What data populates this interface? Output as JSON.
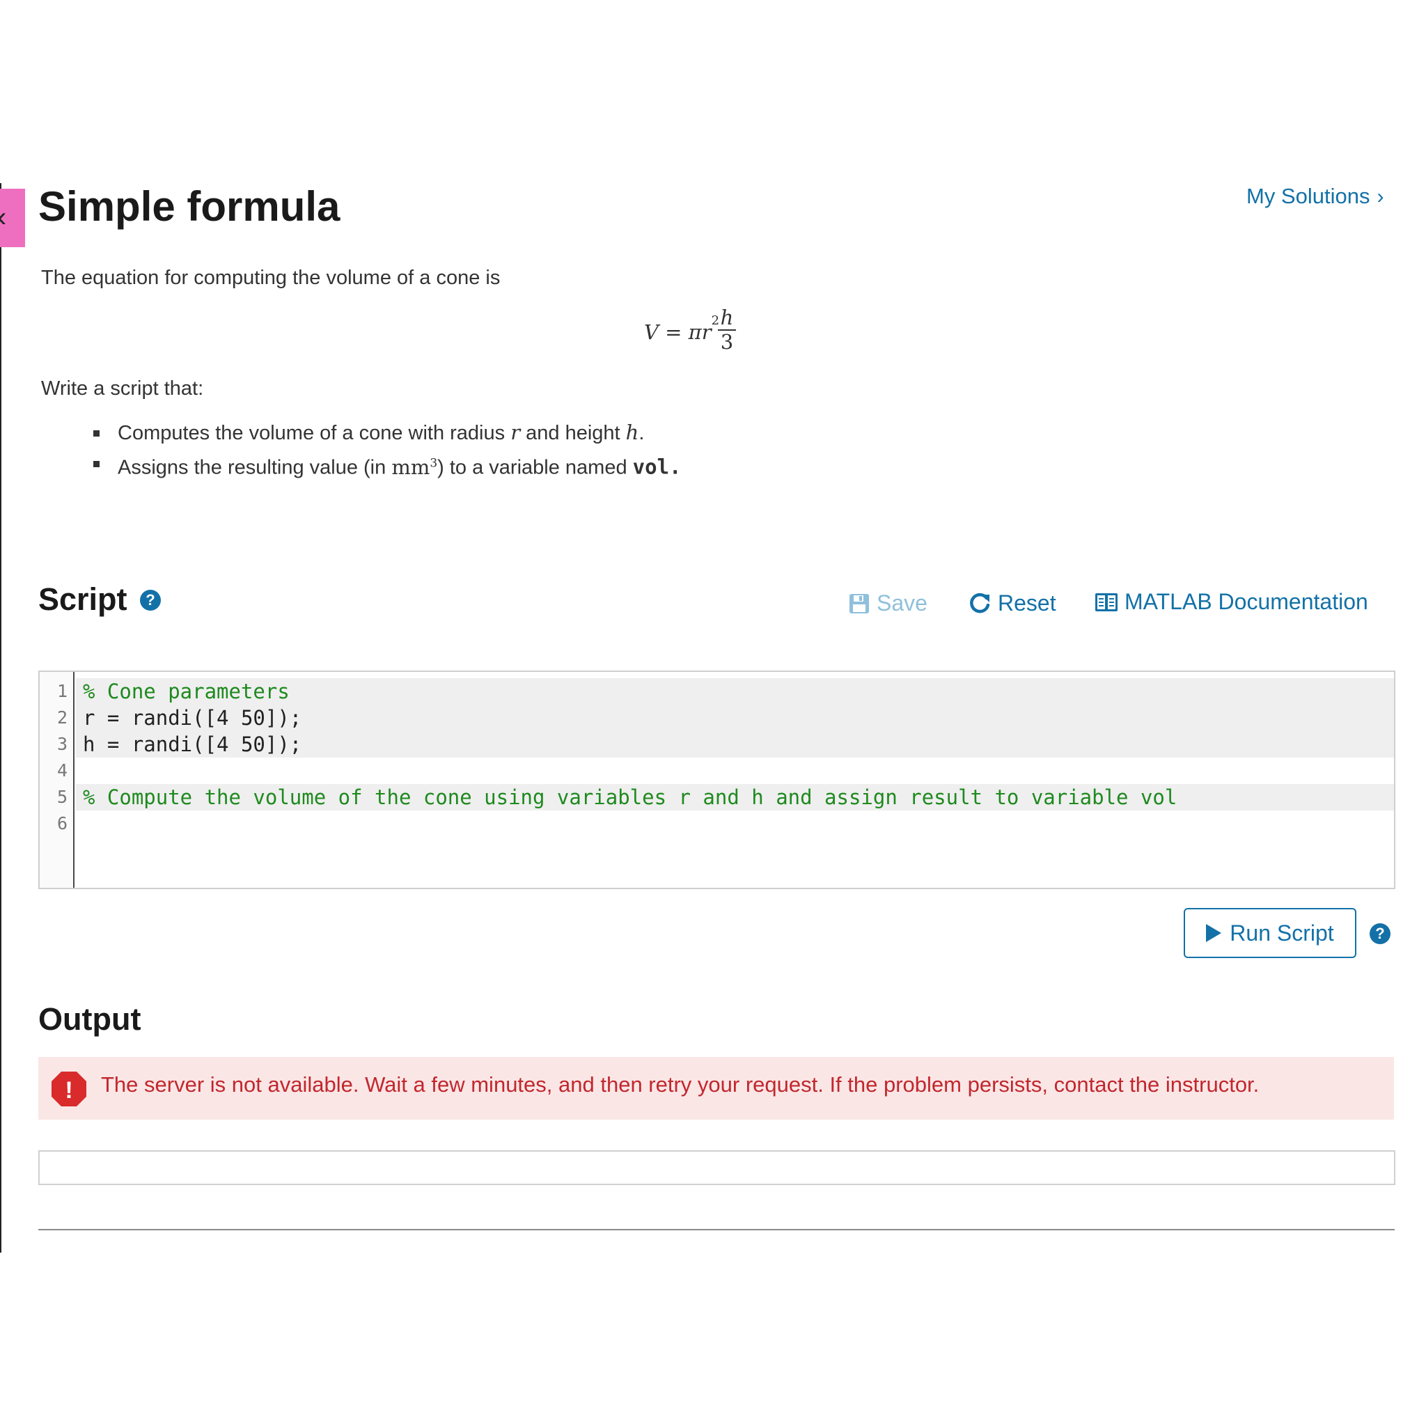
{
  "nav": {
    "tab_chevron": "‹"
  },
  "header": {
    "title": "Simple formula",
    "my_solutions_label": "My Solutions",
    "my_solutions_chevron": "›"
  },
  "problem": {
    "intro": "The equation for computing the volume of a cone is",
    "formula": {
      "lhs": "V = πr",
      "exponent": "2",
      "numerator": "h",
      "denominator": "3"
    },
    "write_label": "Write a script that:",
    "bullet1": {
      "text_a": "Computes the volume of a cone with radius",
      "var_r": "r",
      "text_b": "and height",
      "var_h": "h",
      "period": "."
    },
    "bullet2": {
      "text_a": "Assigns the resulting value (in",
      "unit": "mm",
      "unit_exp": "3",
      "text_b": ") to a variable named",
      "var": "vol."
    }
  },
  "script_section": {
    "title": "Script",
    "help_icon": "?",
    "save_label": "Save",
    "reset_label": "Reset",
    "doc_label": "MATLAB Documentation",
    "icons": {
      "save": "save-icon",
      "reset": "reset-icon",
      "doc": "book-icon"
    },
    "colors": {
      "link": "#1371a8",
      "disabled": "#8fc0dc",
      "comment": "#1e8a1e"
    }
  },
  "editor": {
    "line_numbers": [
      "1",
      "2",
      "3",
      "4",
      "5",
      "6"
    ],
    "lines": [
      "% Cone parameters",
      "r = randi([4 50]);",
      "h = randi([4 50]);",
      "",
      "% Compute the volume of the cone using variables r and h and assign result to variable vol",
      ""
    ]
  },
  "run": {
    "label": "Run Script",
    "help_icon": "?"
  },
  "output": {
    "title": "Output",
    "error_icon": "!",
    "error_message": "The server is not available. Wait a few minutes, and then retry your request. If the problem persists, contact the instructor.",
    "error_colors": {
      "background": "#fbe6e6",
      "text": "#c1272d",
      "icon": "#d92b2b"
    }
  }
}
